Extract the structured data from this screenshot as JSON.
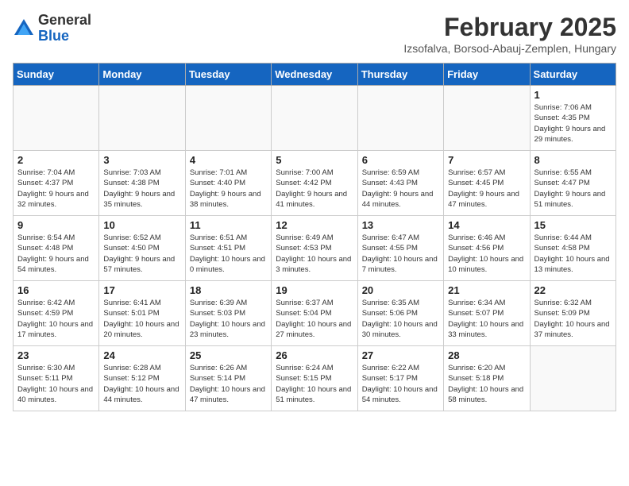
{
  "logo": {
    "general": "General",
    "blue": "Blue"
  },
  "title": "February 2025",
  "subtitle": "Izsofalva, Borsod-Abauj-Zemplen, Hungary",
  "days_of_week": [
    "Sunday",
    "Monday",
    "Tuesday",
    "Wednesday",
    "Thursday",
    "Friday",
    "Saturday"
  ],
  "weeks": [
    [
      {
        "day": "",
        "info": ""
      },
      {
        "day": "",
        "info": ""
      },
      {
        "day": "",
        "info": ""
      },
      {
        "day": "",
        "info": ""
      },
      {
        "day": "",
        "info": ""
      },
      {
        "day": "",
        "info": ""
      },
      {
        "day": "1",
        "info": "Sunrise: 7:06 AM\nSunset: 4:35 PM\nDaylight: 9 hours and 29 minutes."
      }
    ],
    [
      {
        "day": "2",
        "info": "Sunrise: 7:04 AM\nSunset: 4:37 PM\nDaylight: 9 hours and 32 minutes."
      },
      {
        "day": "3",
        "info": "Sunrise: 7:03 AM\nSunset: 4:38 PM\nDaylight: 9 hours and 35 minutes."
      },
      {
        "day": "4",
        "info": "Sunrise: 7:01 AM\nSunset: 4:40 PM\nDaylight: 9 hours and 38 minutes."
      },
      {
        "day": "5",
        "info": "Sunrise: 7:00 AM\nSunset: 4:42 PM\nDaylight: 9 hours and 41 minutes."
      },
      {
        "day": "6",
        "info": "Sunrise: 6:59 AM\nSunset: 4:43 PM\nDaylight: 9 hours and 44 minutes."
      },
      {
        "day": "7",
        "info": "Sunrise: 6:57 AM\nSunset: 4:45 PM\nDaylight: 9 hours and 47 minutes."
      },
      {
        "day": "8",
        "info": "Sunrise: 6:55 AM\nSunset: 4:47 PM\nDaylight: 9 hours and 51 minutes."
      }
    ],
    [
      {
        "day": "9",
        "info": "Sunrise: 6:54 AM\nSunset: 4:48 PM\nDaylight: 9 hours and 54 minutes."
      },
      {
        "day": "10",
        "info": "Sunrise: 6:52 AM\nSunset: 4:50 PM\nDaylight: 9 hours and 57 minutes."
      },
      {
        "day": "11",
        "info": "Sunrise: 6:51 AM\nSunset: 4:51 PM\nDaylight: 10 hours and 0 minutes."
      },
      {
        "day": "12",
        "info": "Sunrise: 6:49 AM\nSunset: 4:53 PM\nDaylight: 10 hours and 3 minutes."
      },
      {
        "day": "13",
        "info": "Sunrise: 6:47 AM\nSunset: 4:55 PM\nDaylight: 10 hours and 7 minutes."
      },
      {
        "day": "14",
        "info": "Sunrise: 6:46 AM\nSunset: 4:56 PM\nDaylight: 10 hours and 10 minutes."
      },
      {
        "day": "15",
        "info": "Sunrise: 6:44 AM\nSunset: 4:58 PM\nDaylight: 10 hours and 13 minutes."
      }
    ],
    [
      {
        "day": "16",
        "info": "Sunrise: 6:42 AM\nSunset: 4:59 PM\nDaylight: 10 hours and 17 minutes."
      },
      {
        "day": "17",
        "info": "Sunrise: 6:41 AM\nSunset: 5:01 PM\nDaylight: 10 hours and 20 minutes."
      },
      {
        "day": "18",
        "info": "Sunrise: 6:39 AM\nSunset: 5:03 PM\nDaylight: 10 hours and 23 minutes."
      },
      {
        "day": "19",
        "info": "Sunrise: 6:37 AM\nSunset: 5:04 PM\nDaylight: 10 hours and 27 minutes."
      },
      {
        "day": "20",
        "info": "Sunrise: 6:35 AM\nSunset: 5:06 PM\nDaylight: 10 hours and 30 minutes."
      },
      {
        "day": "21",
        "info": "Sunrise: 6:34 AM\nSunset: 5:07 PM\nDaylight: 10 hours and 33 minutes."
      },
      {
        "day": "22",
        "info": "Sunrise: 6:32 AM\nSunset: 5:09 PM\nDaylight: 10 hours and 37 minutes."
      }
    ],
    [
      {
        "day": "23",
        "info": "Sunrise: 6:30 AM\nSunset: 5:11 PM\nDaylight: 10 hours and 40 minutes."
      },
      {
        "day": "24",
        "info": "Sunrise: 6:28 AM\nSunset: 5:12 PM\nDaylight: 10 hours and 44 minutes."
      },
      {
        "day": "25",
        "info": "Sunrise: 6:26 AM\nSunset: 5:14 PM\nDaylight: 10 hours and 47 minutes."
      },
      {
        "day": "26",
        "info": "Sunrise: 6:24 AM\nSunset: 5:15 PM\nDaylight: 10 hours and 51 minutes."
      },
      {
        "day": "27",
        "info": "Sunrise: 6:22 AM\nSunset: 5:17 PM\nDaylight: 10 hours and 54 minutes."
      },
      {
        "day": "28",
        "info": "Sunrise: 6:20 AM\nSunset: 5:18 PM\nDaylight: 10 hours and 58 minutes."
      },
      {
        "day": "",
        "info": ""
      }
    ]
  ]
}
